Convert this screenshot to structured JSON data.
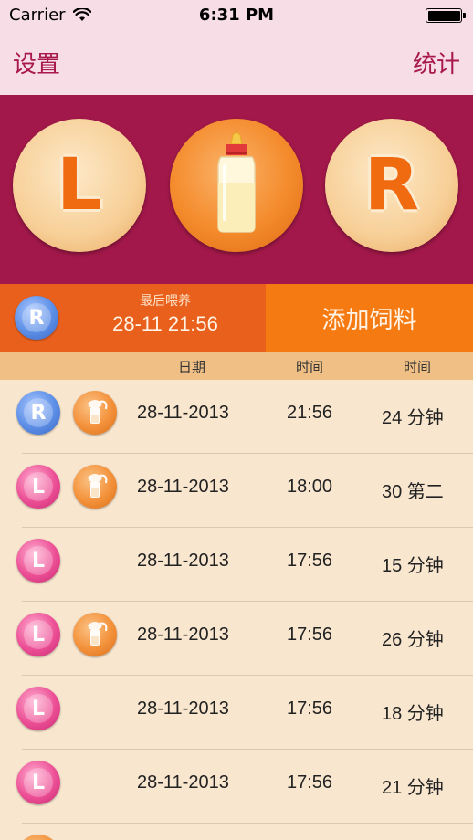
{
  "status_bar": {
    "carrier": "Carrier",
    "time": "6:31 PM"
  },
  "nav": {
    "left_label": "设置",
    "right_label": "统计"
  },
  "hero": {
    "left_letter": "L",
    "right_letter": "R",
    "center_icon": "bottle-icon"
  },
  "summary": {
    "side_letter": "R",
    "caption": "最后喂养",
    "last_feed": "28-11 21:56",
    "add_button": "添加饲料"
  },
  "table": {
    "headers": [
      "日期",
      "时间",
      "时间"
    ],
    "rows": [
      {
        "side": "R",
        "pump": true,
        "date": "28-11-2013",
        "time": "21:56",
        "duration": "24 分钟"
      },
      {
        "side": "L",
        "pump": true,
        "date": "28-11-2013",
        "time": "18:00",
        "duration": "30 第二"
      },
      {
        "side": "L",
        "pump": false,
        "date": "28-11-2013",
        "time": "17:56",
        "duration": "15 分钟"
      },
      {
        "side": "L",
        "pump": true,
        "date": "28-11-2013",
        "time": "17:56",
        "duration": "26 分钟"
      },
      {
        "side": "L",
        "pump": false,
        "date": "28-11-2013",
        "time": "17:56",
        "duration": "18 分钟"
      },
      {
        "side": "L",
        "pump": false,
        "date": "28-11-2013",
        "time": "17:56",
        "duration": "21 分钟"
      }
    ]
  },
  "colors": {
    "nav_bg": "#f6dde6",
    "nav_text": "#a8184c",
    "hero_bg": "#a3184a",
    "summary_left": "#e9601c",
    "summary_right": "#f57a12",
    "header_bg": "#efbf85",
    "list_bg": "#f8e6cf"
  }
}
